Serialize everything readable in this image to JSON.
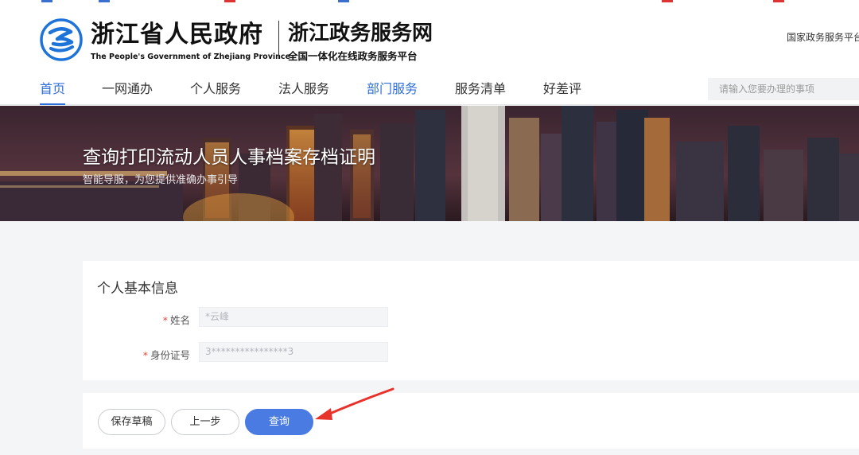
{
  "header": {
    "gov_title": "浙江省人民政府",
    "gov_en": "The People's Government of Zhejiang Province",
    "service_title": "浙江政务服务网",
    "service_subtitle": "全国一体化在线政务服务平台",
    "national_link": "国家政务服务平台"
  },
  "nav": {
    "items": [
      {
        "label": "首页"
      },
      {
        "label": "一网通办"
      },
      {
        "label": "个人服务"
      },
      {
        "label": "法人服务"
      },
      {
        "label": "部门服务"
      },
      {
        "label": "服务清单"
      },
      {
        "label": "好差评"
      }
    ],
    "search_placeholder": "请输入您要办理的事项"
  },
  "banner": {
    "title": "查询打印流动人员人事档案存档证明",
    "subtitle": "智能导服，为您提供准确办事引导"
  },
  "form": {
    "section_title": "个人基本信息",
    "fields": [
      {
        "label": "姓名",
        "required": true,
        "value": "*云峰"
      },
      {
        "label": "身份证号",
        "required": true,
        "value": "3****************3"
      }
    ]
  },
  "actions": {
    "save_draft": "保存草稿",
    "previous": "上一步",
    "query": "查询"
  },
  "colors": {
    "accent": "#2f6fdb",
    "primary_button": "#4a7be3",
    "required_star": "#e64a3b",
    "annotation_arrow": "#e8332d"
  }
}
